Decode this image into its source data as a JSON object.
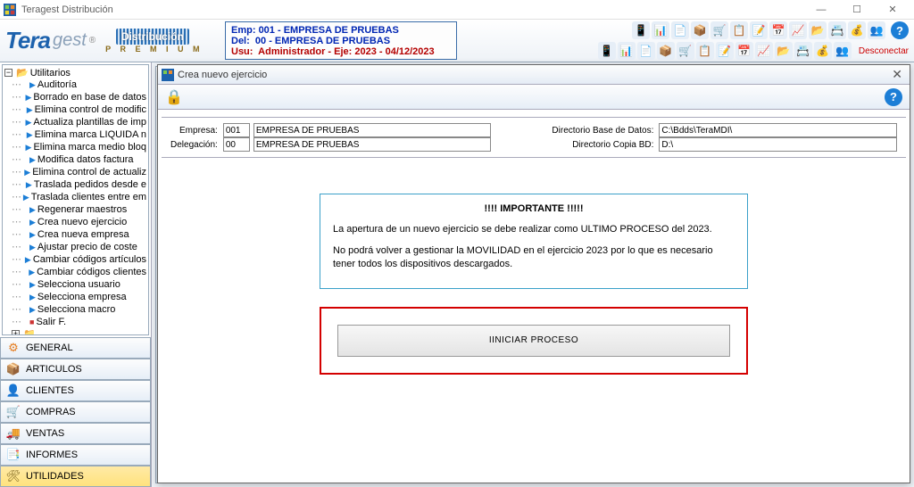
{
  "window": {
    "title": "Teragest Distribución"
  },
  "logo": {
    "tera": "Tera",
    "gest": "gest",
    "reg": "®",
    "dist": "Distribución",
    "prem": "P R E M I U M"
  },
  "header_info": {
    "emp_label": "Emp:",
    "emp_value": "001 - EMPRESA DE PRUEBAS",
    "del_label": "Del:",
    "del_value": "00 - EMPRESA DE PRUEBAS",
    "usu_label": "Usu:",
    "usu_value": "Administrador - Eje: 2023 - 04/12/2023"
  },
  "disconnect": "Desconectar",
  "tree": {
    "root": "Utilitarios",
    "items": [
      "Auditoría",
      "Borrado en base de datos",
      "Elimina control de modific",
      "Actualiza plantillas de imp",
      "Elimina marca LIQUIDA n",
      "Elimina marca medio bloq",
      "Modifica datos factura",
      "Elimina control de actualiz",
      "Traslada pedidos desde e",
      "Traslada clientes entre em",
      "Regenerar maestros",
      "Crea nuevo ejercicio",
      "Crea nueva empresa",
      "Ajustar precio de coste",
      "Cambiar códigos artículos",
      "Cambiar códigos clientes",
      "Selecciona usuario",
      "Selecciona empresa",
      "Selecciona macro",
      "Salir F."
    ]
  },
  "categories": [
    {
      "icon": "⚙",
      "label": "GENERAL",
      "color": "#e57c1f"
    },
    {
      "icon": "📦",
      "label": "ARTICULOS",
      "color": "#c68a2b"
    },
    {
      "icon": "👤",
      "label": "CLIENTES",
      "color": "#2b74c6"
    },
    {
      "icon": "🛒",
      "label": "COMPRAS",
      "color": "#2aa845"
    },
    {
      "icon": "🚚",
      "label": "VENTAS",
      "color": "#c2452a"
    },
    {
      "icon": "📑",
      "label": "INFORMES",
      "color": "#4a6fa5"
    },
    {
      "icon": "🛠",
      "label": "UTILIDADES",
      "color": "#7a621b"
    }
  ],
  "modal": {
    "title": "Crea nuevo ejercicio",
    "form": {
      "empresa_label": "Empresa:",
      "empresa_code": "001",
      "empresa_name": "EMPRESA DE PRUEBAS",
      "delegacion_label": "Delegación:",
      "delegacion_code": "00",
      "delegacion_name": "EMPRESA DE PRUEBAS",
      "dir_bd_label": "Directorio Base de Datos:",
      "dir_bd_value": "C:\\Bdds\\TeraMDI\\",
      "dir_copia_label": "Directorio Copia BD:",
      "dir_copia_value": "D:\\"
    },
    "warning": {
      "title": "!!!! IMPORTANTE !!!!!",
      "p1": "La apertura de un nuevo ejercicio se debe realizar como ULTIMO PROCESO del 2023.",
      "p2": "No podrá volver a gestionar la MOVILIDAD en el ejercicio 2023 por lo que es necesario tener todos los dispositivos descargados."
    },
    "action": "IINICIAR PROCESO"
  }
}
